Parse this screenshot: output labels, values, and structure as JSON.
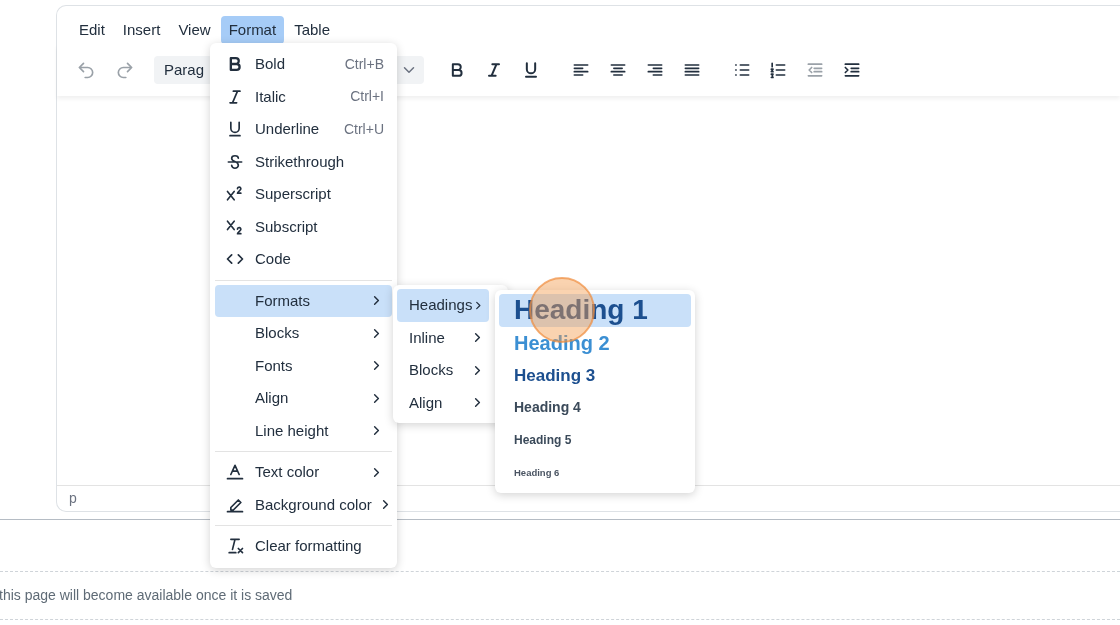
{
  "menubar": [
    {
      "label": "Edit",
      "selected": false
    },
    {
      "label": "Insert",
      "selected": false
    },
    {
      "label": "View",
      "selected": false
    },
    {
      "label": "Format",
      "selected": true
    },
    {
      "label": "Table",
      "selected": false
    }
  ],
  "toolbar": {
    "block_format": "Parag",
    "buttons": [
      {
        "disabled": true
      },
      {
        "disabled": true
      },
      {
        "disabled": false
      },
      {
        "disabled": false
      },
      {
        "disabled": false
      },
      {
        "disabled": false
      },
      {
        "disabled": false
      },
      {
        "disabled": false
      },
      {
        "disabled": false
      },
      {
        "disabled": false
      },
      {
        "disabled": false
      },
      {
        "disabled": true
      },
      {
        "disabled": false
      }
    ]
  },
  "format_menu": {
    "sections": [
      [
        {
          "label": "Bold",
          "shortcut": "Ctrl+B",
          "has_submenu": false,
          "selected": false
        },
        {
          "label": "Italic",
          "shortcut": "Ctrl+I",
          "has_submenu": false,
          "selected": false
        },
        {
          "label": "Underline",
          "shortcut": "Ctrl+U",
          "has_submenu": false,
          "selected": false
        },
        {
          "label": "Strikethrough",
          "has_submenu": false,
          "selected": false
        },
        {
          "label": "Superscript",
          "has_submenu": false,
          "selected": false
        },
        {
          "label": "Subscript",
          "has_submenu": false,
          "selected": false
        },
        {
          "label": "Code",
          "has_submenu": false,
          "selected": false
        }
      ],
      [
        {
          "label": "Formats",
          "has_submenu": true,
          "selected": true
        },
        {
          "label": "Blocks",
          "has_submenu": true,
          "selected": false
        },
        {
          "label": "Fonts",
          "has_submenu": true,
          "selected": false
        },
        {
          "label": "Align",
          "has_submenu": true,
          "selected": false
        },
        {
          "label": "Line height",
          "has_submenu": true,
          "selected": false
        }
      ],
      [
        {
          "label": "Text color",
          "has_submenu": true,
          "selected": false
        },
        {
          "label": "Background color",
          "has_submenu": true,
          "selected": false
        }
      ],
      [
        {
          "label": "Clear formatting",
          "has_submenu": false,
          "selected": false
        }
      ]
    ]
  },
  "formats_submenu": {
    "items": [
      {
        "label": "Headings",
        "selected": true
      },
      {
        "label": "Inline",
        "selected": false
      },
      {
        "label": "Blocks",
        "selected": false
      },
      {
        "label": "Align",
        "selected": false
      }
    ]
  },
  "headings_submenu": {
    "items": [
      {
        "label": "Heading 1",
        "selected": true
      },
      {
        "label": "Heading 2",
        "selected": false
      },
      {
        "label": "Heading 3",
        "selected": false
      },
      {
        "label": "Heading 4",
        "selected": false
      },
      {
        "label": "Heading 5",
        "selected": false
      },
      {
        "label": "Heading 6",
        "selected": false
      }
    ]
  },
  "status_bar": {
    "path": "p"
  },
  "note": "this page will become available once it is saved"
}
